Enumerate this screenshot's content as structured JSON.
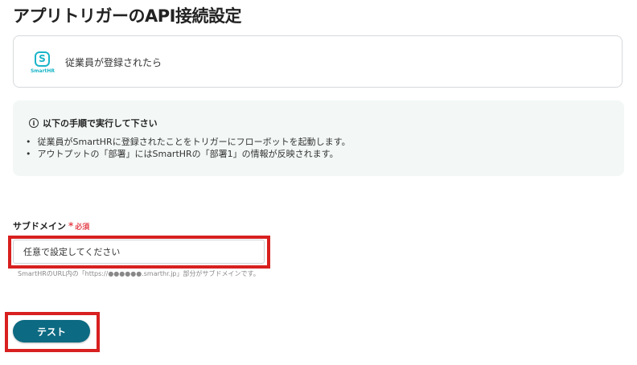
{
  "page_title": "アプリトリガーのAPI接続設定",
  "app_card": {
    "logo_symbol": "S",
    "logo_name": "SmartHR",
    "trigger_label": "従業員が登録されたら"
  },
  "info": {
    "icon": "info-icon",
    "heading": "以下の手順で実行して下さい",
    "items": [
      "従業員がSmartHRに登録されたことをトリガーにフローボットを起動します。",
      "アウトプットの「部署」にはSmartHRの「部署1」の情報が反映されます。"
    ]
  },
  "subdomain": {
    "label": "サブドメイン",
    "required_mark": "*",
    "required_text": "必須",
    "placeholder": "任意で設定してください",
    "value": "",
    "help": "SmartHRのURL内の「https://●●●●●●.smarthr.jp」部分がサブドメインです。"
  },
  "test_button_label": "テスト",
  "colors": {
    "accent": "#0c6a82",
    "brand": "#1ab5c8",
    "required": "#e5454d",
    "highlight": "#d7201f",
    "info_bg": "#f3f8f7"
  }
}
